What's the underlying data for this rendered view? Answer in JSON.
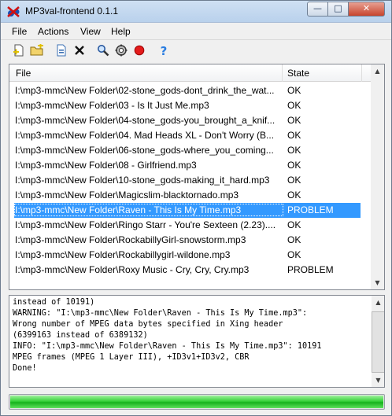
{
  "window": {
    "title": "MP3val-frontend 0.1.1",
    "controls": {
      "minimize": "—",
      "maximize": "□",
      "close": "✕"
    }
  },
  "menu": {
    "file": "File",
    "actions": "Actions",
    "view": "View",
    "help": "Help"
  },
  "toolbar": {
    "icons": [
      "add-file-icon",
      "add-folder-icon",
      "remove-icon",
      "delete-icon",
      "scan-icon",
      "fix-icon",
      "stop-icon",
      "help-icon"
    ],
    "help_glyph": "?"
  },
  "list": {
    "columns": [
      "File",
      "State"
    ],
    "rows": [
      {
        "file": "I:\\mp3-mmc\\New Folder\\02-stone_gods-dont_drink_the_wat...",
        "state": "OK"
      },
      {
        "file": "I:\\mp3-mmc\\New Folder\\03 - Is It Just Me.mp3",
        "state": "OK"
      },
      {
        "file": "I:\\mp3-mmc\\New Folder\\04-stone_gods-you_brought_a_knif...",
        "state": "OK"
      },
      {
        "file": "I:\\mp3-mmc\\New Folder\\04. Mad Heads XL - Don't Worry (B...",
        "state": "OK"
      },
      {
        "file": "I:\\mp3-mmc\\New Folder\\06-stone_gods-where_you_coming...",
        "state": "OK"
      },
      {
        "file": "I:\\mp3-mmc\\New Folder\\08 - Girlfriend.mp3",
        "state": "OK"
      },
      {
        "file": "I:\\mp3-mmc\\New Folder\\10-stone_gods-making_it_hard.mp3",
        "state": "OK"
      },
      {
        "file": "I:\\mp3-mmc\\New Folder\\Magicslim-blacktornado.mp3",
        "state": "OK"
      },
      {
        "file": "I:\\mp3-mmc\\New Folder\\Raven - This Is My Time.mp3",
        "state": "PROBLEM",
        "selected": true
      },
      {
        "file": "I:\\mp3-mmc\\New Folder\\Ringo Starr - You're Sexteen (2.23)....",
        "state": "OK"
      },
      {
        "file": "I:\\mp3-mmc\\New Folder\\RockabillyGirl-snowstorm.mp3",
        "state": "OK"
      },
      {
        "file": "I:\\mp3-mmc\\New Folder\\Rockabillygirl-wildone.mp3",
        "state": "OK"
      },
      {
        "file": "I:\\mp3-mmc\\New Folder\\Roxy Music - Cry, Cry, Cry.mp3",
        "state": "PROBLEM"
      }
    ]
  },
  "log": {
    "text": "instead of 10191)\nWARNING: \"I:\\mp3-mmc\\New Folder\\Raven - This Is My Time.mp3\":\nWrong number of MPEG data bytes specified in Xing header\n(6399163 instead of 6389132)\nINFO: \"I:\\mp3-mmc\\New Folder\\Raven - This Is My Time.mp3\": 10191\nMPEG frames (MPEG 1 Layer III), +ID3v1+ID3v2, CBR\nDone!"
  },
  "progress": {
    "value": 1.0
  },
  "scroll_arrows": {
    "up": "▲",
    "down": "▼"
  }
}
